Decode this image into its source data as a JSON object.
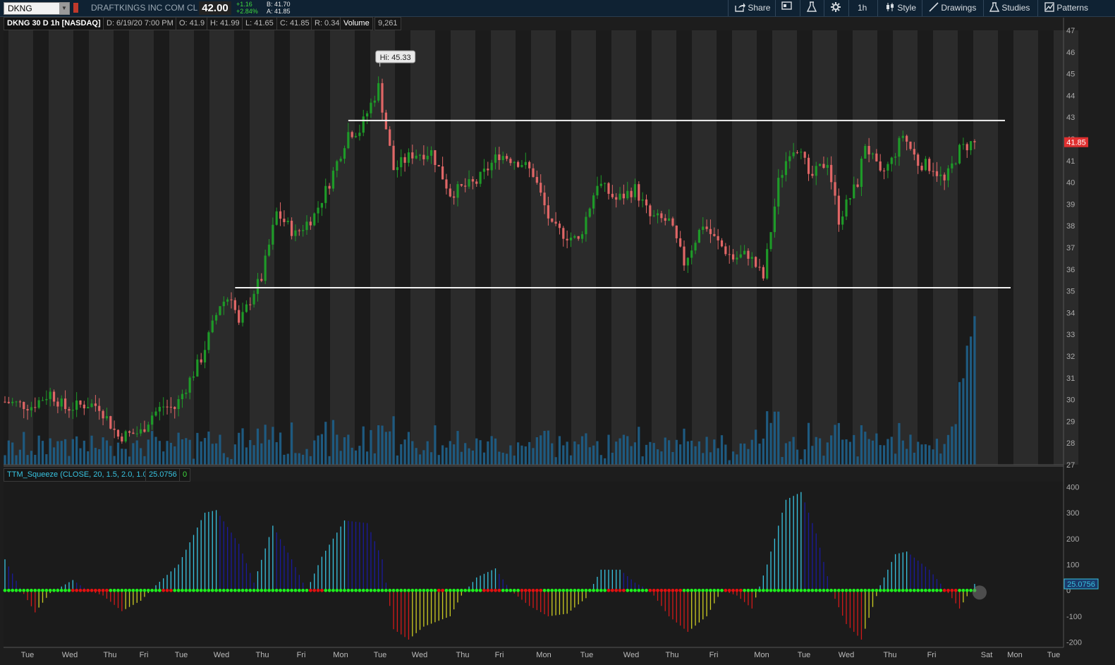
{
  "toolbar": {
    "symbol": "DKNG",
    "company": "DRAFTKINGS INC COM CL A",
    "last": "42.00",
    "change": "+1.16",
    "change_pct": "+2.84%",
    "bid": "B: 41.70",
    "ask": "A: 41.85",
    "buttons": {
      "share": "Share",
      "timeframe": "1h",
      "style": "Style",
      "drawings": "Drawings",
      "studies": "Studies",
      "patterns": "Patterns"
    }
  },
  "info": {
    "title": "DKNG 30 D 1h [NASDAQ]",
    "date": "D: 6/19/20 7:00 PM",
    "open": "O: 41.9",
    "high": "H: 41.99",
    "low": "L: 41.65",
    "close": "C: 41.85",
    "range": "R: 0.34",
    "volume_label": "Volume",
    "volume_value": "9,261"
  },
  "study": {
    "label": "TTM_Squeeze (CLOSE, 20, 1.5, 2.0, 1.0)",
    "value": "25.0756",
    "value2": "0"
  },
  "colors": {
    "up": "#1e9a28",
    "down": "#e06666",
    "volume": "#1e5a80",
    "bg_band": "#2b2b2b",
    "bg_dark": "#1b1b1b",
    "hist_cyan": "#38c3e0",
    "hist_blue": "#1a1a9c",
    "hist_red": "#d11a1a",
    "hist_yellow": "#cccc22",
    "dot_green": "#1df01d",
    "dot_red": "#e31010",
    "price_marker": "#e03030"
  },
  "chart_data": [
    {
      "type": "candlestick",
      "title": "DKNG 30 D 1h [NASDAQ]",
      "ylim": [
        27,
        47
      ],
      "y_ticks": [
        "47",
        "46",
        "45",
        "44",
        "43",
        "42",
        "41",
        "40",
        "39",
        "38",
        "37",
        "36",
        "35",
        "34",
        "33",
        "32",
        "31",
        "30",
        "29",
        "28",
        "27"
      ],
      "x_ticks": [
        "Tue",
        "Wed",
        "Thu",
        "Fri",
        "Tue",
        "Wed",
        "Thu",
        "Fri",
        "Mon",
        "Tue",
        "Wed",
        "Thu",
        "Fri",
        "Mon",
        "Tue",
        "Wed",
        "Thu",
        "Fri",
        "Mon",
        "Tue",
        "Wed",
        "Thu",
        "Fri",
        "Sat",
        "Mon",
        "Tue"
      ],
      "high_annotation": "Hi: 45.33",
      "high": 45.33,
      "last_price": "41.85",
      "horizontal_lines": [
        42.85,
        35.15
      ],
      "price_path": [
        {
          "x": 0,
          "y": 29.9
        },
        {
          "x": 7,
          "y": 29.7
        },
        {
          "x": 12,
          "y": 30.3
        },
        {
          "x": 16,
          "y": 29.6
        },
        {
          "x": 22,
          "y": 29.8
        },
        {
          "x": 25,
          "y": 29.7
        },
        {
          "x": 30,
          "y": 28.3
        },
        {
          "x": 36,
          "y": 28.5
        },
        {
          "x": 39,
          "y": 29.3
        },
        {
          "x": 42,
          "y": 29.7
        },
        {
          "x": 45,
          "y": 29.6
        },
        {
          "x": 52,
          "y": 31.9
        },
        {
          "x": 57,
          "y": 34.4
        },
        {
          "x": 60,
          "y": 34.8
        },
        {
          "x": 62,
          "y": 33.4
        },
        {
          "x": 66,
          "y": 35.0
        },
        {
          "x": 68,
          "y": 35.6
        },
        {
          "x": 72,
          "y": 38.6
        },
        {
          "x": 77,
          "y": 37.6
        },
        {
          "x": 82,
          "y": 38.5
        },
        {
          "x": 86,
          "y": 40.0
        },
        {
          "x": 91,
          "y": 42.3
        },
        {
          "x": 94,
          "y": 42.4
        },
        {
          "x": 99,
          "y": 44.4
        },
        {
          "x": 103,
          "y": 40.6
        },
        {
          "x": 108,
          "y": 41.3
        },
        {
          "x": 113,
          "y": 41.4
        },
        {
          "x": 118,
          "y": 39.5
        },
        {
          "x": 122,
          "y": 39.8
        },
        {
          "x": 125,
          "y": 40.0
        },
        {
          "x": 131,
          "y": 41.3
        },
        {
          "x": 137,
          "y": 40.9
        },
        {
          "x": 140,
          "y": 40.4
        },
        {
          "x": 145,
          "y": 37.9
        },
        {
          "x": 152,
          "y": 37.3
        },
        {
          "x": 157,
          "y": 40.0
        },
        {
          "x": 162,
          "y": 39.2
        },
        {
          "x": 167,
          "y": 39.7
        },
        {
          "x": 171,
          "y": 38.4
        },
        {
          "x": 176,
          "y": 38.2
        },
        {
          "x": 180,
          "y": 36.3
        },
        {
          "x": 185,
          "y": 38.1
        },
        {
          "x": 188,
          "y": 37.4
        },
        {
          "x": 193,
          "y": 36.5
        },
        {
          "x": 197,
          "y": 36.7
        },
        {
          "x": 201,
          "y": 35.6
        },
        {
          "x": 205,
          "y": 40.0
        },
        {
          "x": 208,
          "y": 41.5
        },
        {
          "x": 211,
          "y": 41.7
        },
        {
          "x": 213,
          "y": 40.1
        },
        {
          "x": 218,
          "y": 41.0
        },
        {
          "x": 221,
          "y": 38.3
        },
        {
          "x": 226,
          "y": 40.0
        },
        {
          "x": 228,
          "y": 41.8
        },
        {
          "x": 232,
          "y": 40.3
        },
        {
          "x": 235,
          "y": 41.0
        },
        {
          "x": 238,
          "y": 42.2
        },
        {
          "x": 242,
          "y": 40.9
        },
        {
          "x": 246,
          "y": 40.7
        },
        {
          "x": 249,
          "y": 40.0
        },
        {
          "x": 253,
          "y": 41.5
        },
        {
          "x": 256,
          "y": 41.8
        }
      ],
      "volume_series": "shown as bars under price, no axis labels"
    },
    {
      "type": "bar",
      "title": "TTM_Squeeze (CLOSE, 20, 1.5, 2.0, 1.0)",
      "ylim": [
        -220,
        420
      ],
      "y_ticks": [
        "400",
        "300",
        "200",
        "100",
        "0",
        "-100",
        "-200"
      ],
      "last_value": "25.0756",
      "momentum_path": [
        {
          "x": 0,
          "y": 120
        },
        {
          "x": 4,
          "y": 10
        },
        {
          "x": 8,
          "y": -85
        },
        {
          "x": 12,
          "y": -10
        },
        {
          "x": 18,
          "y": 40
        },
        {
          "x": 22,
          "y": 0
        },
        {
          "x": 26,
          "y": -20
        },
        {
          "x": 31,
          "y": -80
        },
        {
          "x": 36,
          "y": -40
        },
        {
          "x": 40,
          "y": 20
        },
        {
          "x": 46,
          "y": 100
        },
        {
          "x": 53,
          "y": 300
        },
        {
          "x": 56,
          "y": 310
        },
        {
          "x": 62,
          "y": 180
        },
        {
          "x": 66,
          "y": 30
        },
        {
          "x": 71,
          "y": 250
        },
        {
          "x": 76,
          "y": 120
        },
        {
          "x": 80,
          "y": 0
        },
        {
          "x": 84,
          "y": 130
        },
        {
          "x": 90,
          "y": 270
        },
        {
          "x": 96,
          "y": 260
        },
        {
          "x": 100,
          "y": 120
        },
        {
          "x": 103,
          "y": -150
        },
        {
          "x": 107,
          "y": -190
        },
        {
          "x": 111,
          "y": -140
        },
        {
          "x": 118,
          "y": -100
        },
        {
          "x": 121,
          "y": -20
        },
        {
          "x": 125,
          "y": 50
        },
        {
          "x": 130,
          "y": 85
        },
        {
          "x": 134,
          "y": 0
        },
        {
          "x": 139,
          "y": -60
        },
        {
          "x": 144,
          "y": -100
        },
        {
          "x": 149,
          "y": -90
        },
        {
          "x": 154,
          "y": -30
        },
        {
          "x": 158,
          "y": 80
        },
        {
          "x": 163,
          "y": 80
        },
        {
          "x": 167,
          "y": 30
        },
        {
          "x": 171,
          "y": 0
        },
        {
          "x": 176,
          "y": -100
        },
        {
          "x": 181,
          "y": -160
        },
        {
          "x": 186,
          "y": -100
        },
        {
          "x": 190,
          "y": 0
        },
        {
          "x": 194,
          "y": -20
        },
        {
          "x": 198,
          "y": -70
        },
        {
          "x": 202,
          "y": 100
        },
        {
          "x": 207,
          "y": 350
        },
        {
          "x": 211,
          "y": 380
        },
        {
          "x": 215,
          "y": 220
        },
        {
          "x": 219,
          "y": 0
        },
        {
          "x": 223,
          "y": -130
        },
        {
          "x": 227,
          "y": -190
        },
        {
          "x": 232,
          "y": 20
        },
        {
          "x": 236,
          "y": 140
        },
        {
          "x": 239,
          "y": 150
        },
        {
          "x": 245,
          "y": 80
        },
        {
          "x": 250,
          "y": -10
        },
        {
          "x": 253,
          "y": -70
        },
        {
          "x": 257,
          "y": 25
        }
      ],
      "squeeze_red_spans": [
        [
          18,
          27
        ],
        [
          42,
          44
        ],
        [
          81,
          84
        ],
        [
          115,
          116
        ],
        [
          127,
          131
        ],
        [
          137,
          142
        ],
        [
          160,
          164
        ],
        [
          171,
          179
        ],
        [
          191,
          195
        ],
        [
          249,
          252
        ]
      ]
    }
  ]
}
